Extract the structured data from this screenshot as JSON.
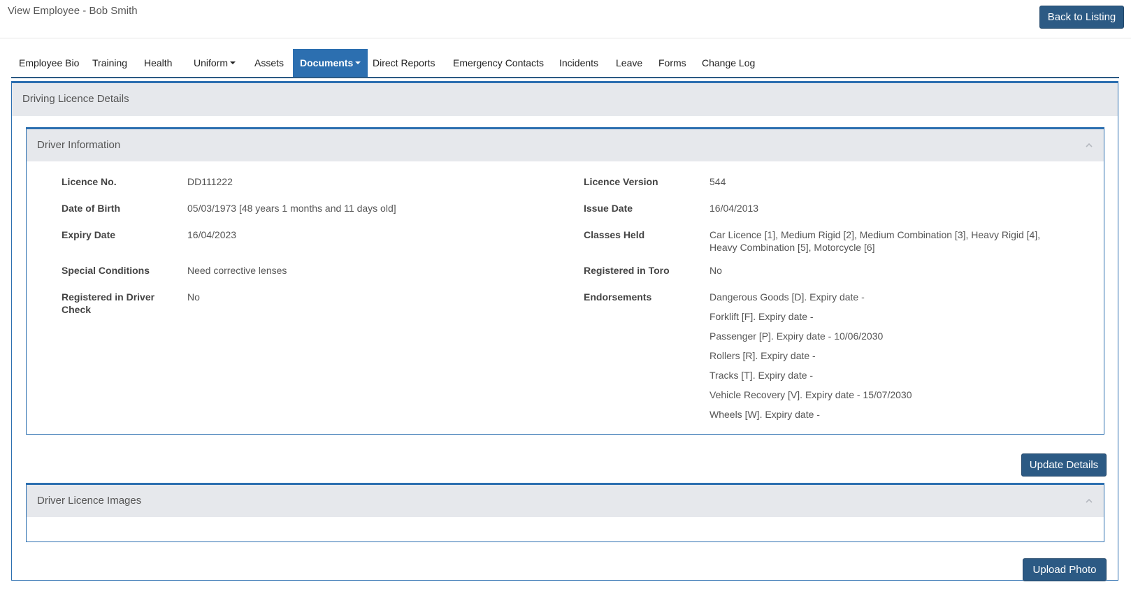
{
  "header": {
    "title": "View Employee - Bob Smith",
    "back_button": "Back to Listing"
  },
  "tabs": [
    {
      "label": "Employee Bio"
    },
    {
      "label": "Training"
    },
    {
      "label": "Health"
    },
    {
      "label": "Uniform",
      "dropdown": true
    },
    {
      "label": "Assets"
    },
    {
      "label": "Documents",
      "dropdown": true,
      "active": true
    },
    {
      "label": "Direct Reports"
    },
    {
      "label": "Emergency Contacts"
    },
    {
      "label": "Incidents"
    },
    {
      "label": "Leave"
    },
    {
      "label": "Forms"
    },
    {
      "label": "Change Log"
    }
  ],
  "licence_panel": {
    "title": "Driving Licence Details"
  },
  "driver_info": {
    "title": "Driver Information",
    "left_fields": [
      {
        "label": "Licence No.",
        "value": "DD111222"
      },
      {
        "label": "Date of Birth",
        "value": "05/03/1973 [48 years 1 months and 11 days old]"
      },
      {
        "label": "Expiry Date",
        "value": "16/04/2023"
      },
      {
        "label": "Special Conditions",
        "value": "Need corrective lenses"
      },
      {
        "label": "Registered in Driver Check",
        "value": "No"
      }
    ],
    "right_fields": [
      {
        "label": "Licence Version",
        "value": "544"
      },
      {
        "label": "Issue Date",
        "value": "16/04/2013"
      },
      {
        "label": "Classes Held",
        "value": "Car Licence [1], Medium Rigid [2], Medium Combination [3], Heavy Rigid [4], Heavy Combination [5], Motorcycle [6]"
      },
      {
        "label": "Registered in Toro",
        "value": "No"
      },
      {
        "label": "Endorsements",
        "value": ""
      }
    ],
    "endorsements": [
      "Dangerous Goods [D]. Expiry date -",
      "Forklift [F]. Expiry date -",
      "Passenger [P]. Expiry date - 10/06/2030",
      "Rollers [R]. Expiry date -",
      "Tracks [T]. Expiry date -",
      "Vehicle Recovery [V]. Expiry date - 15/07/2030",
      "Wheels [W]. Expiry date -"
    ],
    "update_button": "Update Details"
  },
  "images_panel": {
    "title": "Driver Licence Images",
    "upload_button": "Upload Photo"
  },
  "colors": {
    "primary": "#2c5a84",
    "accent": "#2c6fb0",
    "panel_header_bg": "#e6e8ec"
  }
}
